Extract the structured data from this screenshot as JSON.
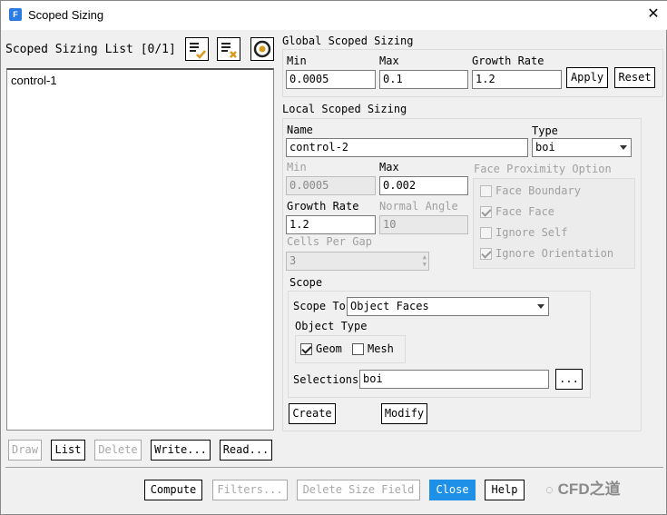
{
  "window": {
    "title": "Scoped Sizing",
    "logo": "F"
  },
  "list": {
    "header": "Scoped Sizing List [0/1]",
    "items": [
      "control-1"
    ],
    "buttons": {
      "draw": "Draw",
      "list": "List",
      "delete": "Delete",
      "write": "Write...",
      "read": "Read..."
    }
  },
  "global": {
    "title": "Global Scoped Sizing",
    "min_label": "Min",
    "min": "0.0005",
    "max_label": "Max",
    "max": "0.1",
    "growth_label": "Growth Rate",
    "growth": "1.2",
    "apply": "Apply",
    "reset": "Reset"
  },
  "local": {
    "title": "Local Scoped Sizing",
    "name_label": "Name",
    "name": "control-2",
    "type_label": "Type",
    "type": "boi",
    "min_label": "Min",
    "min": "0.0005",
    "max_label": "Max",
    "max": "0.002",
    "growth_label": "Growth Rate",
    "growth": "1.2",
    "normal_angle_label": "Normal Angle",
    "normal_angle": "10",
    "cells_label": "Cells Per Gap",
    "cells": "3",
    "face_prox": {
      "title": "Face Proximity Option",
      "options": [
        {
          "label": "Face Boundary",
          "checked": false
        },
        {
          "label": "Face Face",
          "checked": true
        },
        {
          "label": "Ignore Self",
          "checked": false
        },
        {
          "label": "Ignore Orientation",
          "checked": true
        }
      ]
    },
    "scope": {
      "title": "Scope",
      "scope_to_label": "Scope To",
      "scope_to": "Object Faces",
      "object_type_label": "Object Type",
      "geom": "Geom",
      "mesh": "Mesh",
      "selections_label": "Selections",
      "selections": "boi",
      "browse": "..."
    },
    "create": "Create",
    "modify": "Modify"
  },
  "footer": {
    "compute": "Compute",
    "filters": "Filters...",
    "delete_size_field": "Delete Size Field",
    "close": "Close",
    "help": "Help"
  },
  "watermark": "CFD之道"
}
